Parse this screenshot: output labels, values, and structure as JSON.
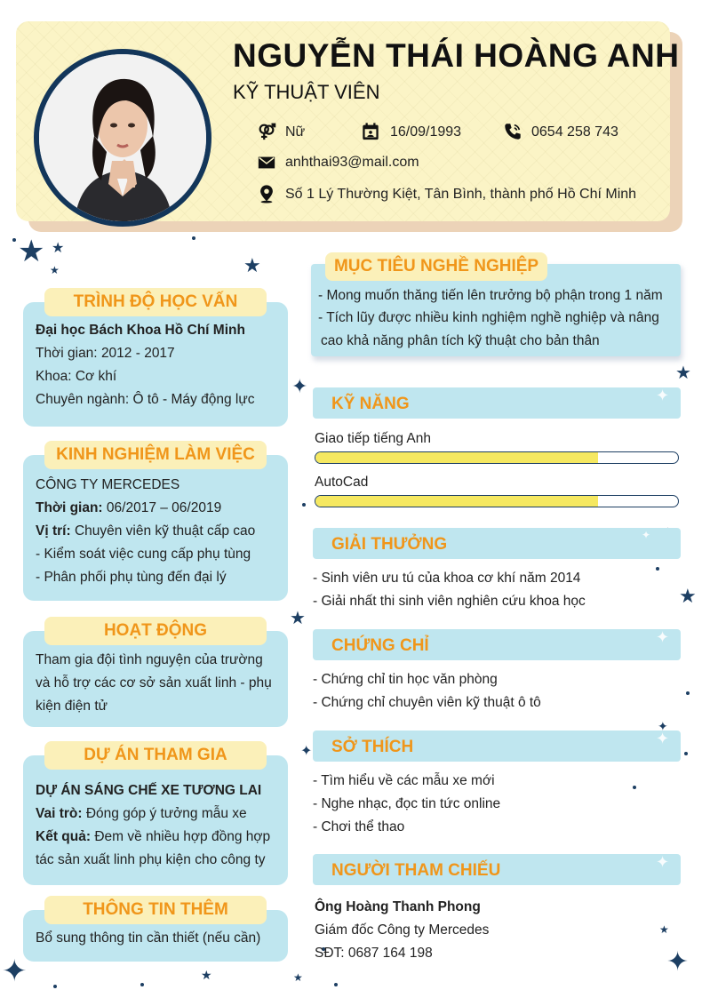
{
  "header": {
    "name": "NGUYỄN THÁI HOÀNG ANH",
    "title": "KỸ THUẬT VIÊN",
    "gender": "Nữ",
    "birthday": "16/09/1993",
    "phone": "0654 258 743",
    "email": "anhthai93@mail.com",
    "address": "Số 1 Lý Thường Kiệt, Tân Bình, thành phố Hồ Chí Minh"
  },
  "education": {
    "title": "TRÌNH ĐỘ HỌC VẤN",
    "school": "Đại học Bách Khoa Hồ Chí Minh",
    "time_label": "Thời gian:",
    "time_value": "2012 - 2017",
    "faculty_label": "Khoa:",
    "faculty_value": "Cơ khí",
    "major_label": "Chuyên ngành:",
    "major_value": "Ô tô - Máy động lực"
  },
  "experience": {
    "title": "KINH NGHIỆM LÀM VIỆC",
    "company": "CÔNG TY MERCEDES",
    "time_label": "Thời gian:",
    "time_value": "06/2017 – 06/2019",
    "position_label": "Vị trí:",
    "position_value": "Chuyên viên kỹ thuật cấp cao",
    "duty1": "- Kiểm soát việc cung cấp phụ tùng",
    "duty2": "- Phân phối phụ tùng đến đại lý"
  },
  "activities": {
    "title": "HOẠT ĐỘNG",
    "line1": "Tham gia đội tình nguyện của trường",
    "line2": "và hỗ trợ các cơ sở sản xuất linh - phụ",
    "line3": "kiện điện tử"
  },
  "projects": {
    "title": "DỰ ÁN THAM GIA",
    "name": "DỰ ÁN SÁNG CHẾ XE TƯƠNG LAI",
    "role_label": "Vai trò:",
    "role_value": "Đóng góp ý tưởng mẫu xe",
    "result_label": "Kết quả:",
    "result_value": "Đem về nhiều hợp đồng hợp",
    "result_value2": "tác sản xuất linh phụ kiện cho công ty"
  },
  "extra": {
    "title": "THÔNG TIN THÊM",
    "line1": "Bổ sung thông tin cần thiết (nếu cần)"
  },
  "goal": {
    "title": "MỤC TIÊU NGHỀ NGHIỆP",
    "line1": "- Mong muốn thăng tiến lên trưởng bộ phận trong 1 năm",
    "line2": "- Tích lũy được nhiều kinh nghiệm nghề nghiệp và nâng",
    "line3": "cao khả năng phân tích kỹ thuật cho bản thân"
  },
  "skills": {
    "title": "KỸ NĂNG",
    "items": [
      {
        "label": "Giao tiếp tiếng Anh",
        "level": 0.78
      },
      {
        "label": "AutoCad",
        "level": 0.78
      }
    ]
  },
  "awards": {
    "title": "GIẢI THƯỞNG",
    "line1": "- Sinh viên ưu tú của khoa cơ khí năm 2014",
    "line2": "- Giải nhất thi sinh viên nghiên cứu khoa học"
  },
  "certificates": {
    "title": "CHỨNG CHỈ",
    "line1": "- Chứng chỉ tin học văn phòng",
    "line2": "- Chứng chỉ chuyên viên kỹ thuật ô tô"
  },
  "hobbies": {
    "title": "SỞ THÍCH",
    "line1": "- Tìm hiểu về các mẫu xe mới",
    "line2": "- Nghe nhạc, đọc tin tức online",
    "line3": "- Chơi thể thao"
  },
  "reference": {
    "title": "NGƯỜI THAM CHIẾU",
    "name": "Ông Hoàng Thanh Phong",
    "position": "Giám đốc Công ty Mercedes",
    "phone": "SĐT: 0687 164 198"
  },
  "colors": {
    "accent": "#f0961a",
    "navy": "#1d3f63",
    "box": "#bfe6ef",
    "header": "#fbf4c6",
    "bar": "#f5e861"
  },
  "icons": [
    "gender-icon",
    "calendar-icon",
    "phone-icon",
    "mail-icon",
    "location-icon",
    "star-icon",
    "sparkle-icon"
  ]
}
